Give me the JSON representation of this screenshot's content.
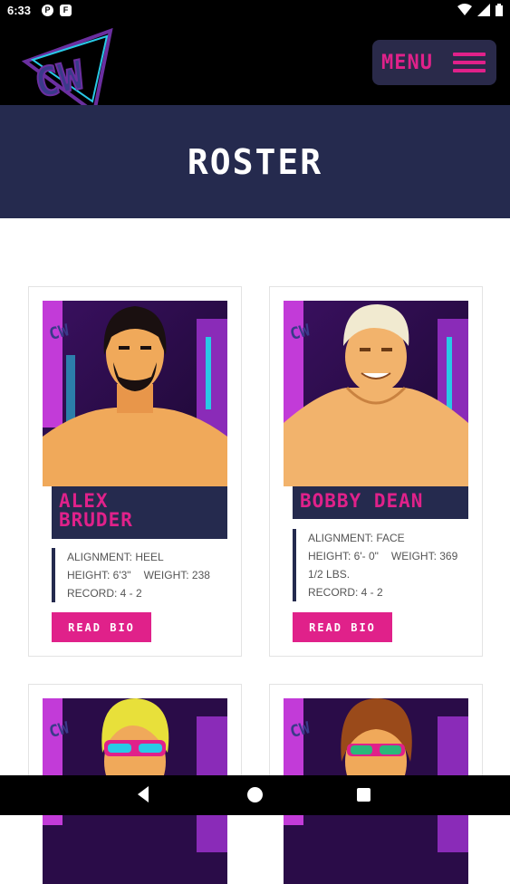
{
  "status_bar": {
    "time": "6:33",
    "notif_1": "P",
    "notif_2": "F"
  },
  "header": {
    "logo_text": "CW",
    "menu_label": "MENU"
  },
  "hero": {
    "title": "ROSTER"
  },
  "roster": [
    {
      "name_line1": "ALEX",
      "name_line2": "BRUDER",
      "alignment": "ALIGNMENT: HEEL",
      "height": "HEIGHT: 6'3\"",
      "weight": "WEIGHT: 238",
      "weight_cont": "",
      "record": "RECORD: 4 - 2",
      "button": "READ BIO"
    },
    {
      "name_line1": "BOBBY DEAN",
      "name_line2": "",
      "alignment": "ALIGNMENT: FACE",
      "height": "HEIGHT: 6'- 0\"",
      "weight": "WEIGHT: 369",
      "weight_cont": "1/2 LBS.",
      "record": "RECORD: 4 - 2",
      "button": "READ BIO"
    }
  ],
  "colors": {
    "accent": "#e0218a",
    "navy": "#252a4e",
    "purple": "#6b2fa0",
    "cyan": "#29c9e6"
  }
}
